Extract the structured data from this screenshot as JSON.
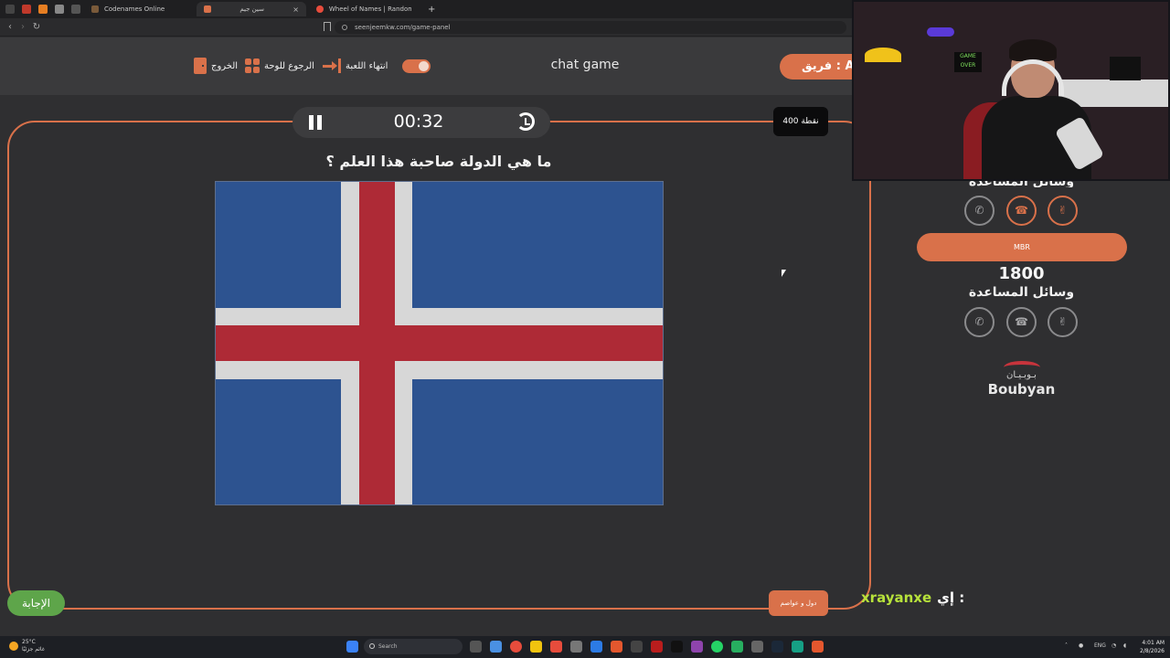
{
  "browser": {
    "tabs": [
      {
        "label": "Codenames Online"
      },
      {
        "label": "سين جيم"
      },
      {
        "label": "Wheel of Names | Random name pic"
      }
    ],
    "url": "seenjeemkw.com/game-panel"
  },
  "header": {
    "exit_label": "الخروج",
    "back_label": "الرجوع للوحة",
    "end_game_label": "انتهاء اللعبة",
    "title": "chat game",
    "team_label": "فريق : AT"
  },
  "game": {
    "timer": "00:32",
    "points": "400 نقطة",
    "question": "ما هي الدولة صاحبة هذا العلم ؟",
    "answer_button": "الإجابة",
    "category_button": "دول و عواصم"
  },
  "flag": {
    "colors": {
      "blue": "#2d5390",
      "white": "#d7d7d7",
      "red": "#ae2a36"
    }
  },
  "sidebar": {
    "help_label_top": "وسائل المساعدة",
    "team_name": "MBR",
    "team_score": "1800",
    "help_label": "وسائل المساعدة",
    "lifelines_top": [
      "hand-phone-icon",
      "phone-icon",
      "peace-hand-icon"
    ],
    "lifelines": [
      "hand-phone-icon",
      "phone-icon",
      "peace-hand-icon"
    ],
    "sponsor_ar": "بـوبـيـان",
    "sponsor_en": "Boubyan"
  },
  "chat": {
    "user": "xrayanxe",
    "message": "إي :"
  },
  "webcam": {
    "sticker": "GAME OVER"
  },
  "taskbar": {
    "temperature": "25°C",
    "weather_desc": "غائم جزئيًا",
    "search_placeholder": "Search",
    "language": "ENG",
    "time": "4:01 AM",
    "date": "2/8/2026"
  },
  "colors": {
    "accent": "#d9714a",
    "background": "#2f2f31",
    "answer": "#5ea54a",
    "chat_user": "#b7e23b"
  }
}
